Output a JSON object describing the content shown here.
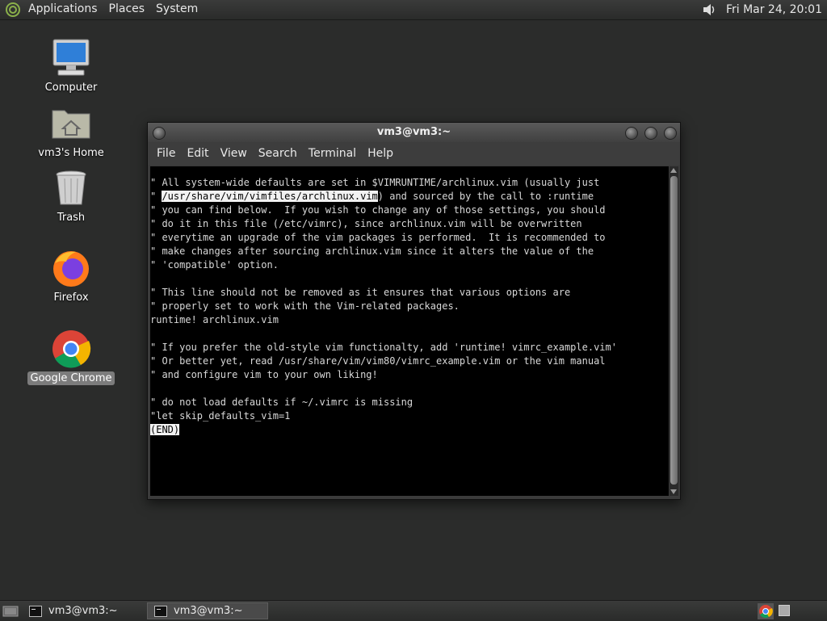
{
  "top_panel": {
    "menus": [
      "Applications",
      "Places",
      "System"
    ],
    "clock": "Fri Mar 24, 20:01"
  },
  "desktop": {
    "icons": [
      {
        "label": "Computer"
      },
      {
        "label": "vm3's Home"
      },
      {
        "label": "Trash"
      },
      {
        "label": "Firefox"
      },
      {
        "label": "Google Chrome"
      }
    ]
  },
  "terminal": {
    "title": "vm3@vm3:~",
    "menu": [
      "File",
      "Edit",
      "View",
      "Search",
      "Terminal",
      "Help"
    ],
    "lines": [
      "\" All system-wide defaults are set in $VIMRUNTIME/archlinux.vim (usually just",
      "\" /usr/share/vim/vimfiles/archlinux.vim) and sourced by the call to :runtime",
      "\" you can find below.  If you wish to change any of those settings, you should",
      "\" do it in this file (/etc/vimrc), since archlinux.vim will be overwritten",
      "\" everytime an upgrade of the vim packages is performed.  It is recommended to",
      "\" make changes after sourcing archlinux.vim since it alters the value of the",
      "\" 'compatible' option.",
      "",
      "\" This line should not be removed as it ensures that various options are",
      "\" properly set to work with the Vim-related packages.",
      "runtime! archlinux.vim",
      "",
      "\" If you prefer the old-style vim functionalty, add 'runtime! vimrc_example.vim'",
      "\" Or better yet, read /usr/share/vim/vim80/vimrc_example.vim or the vim manual",
      "\" and configure vim to your own liking!",
      "",
      "\" do not load defaults if ~/.vimrc is missing",
      "\"let skip_defaults_vim=1"
    ],
    "highlight_line_index": 1,
    "highlight_text": "/usr/share/vim/vimfiles/archlinux.vim",
    "status": "(END)"
  },
  "taskbar": {
    "tasks": [
      {
        "label": "vm3@vm3:~",
        "active": false
      },
      {
        "label": "vm3@vm3:~",
        "active": true
      }
    ]
  }
}
